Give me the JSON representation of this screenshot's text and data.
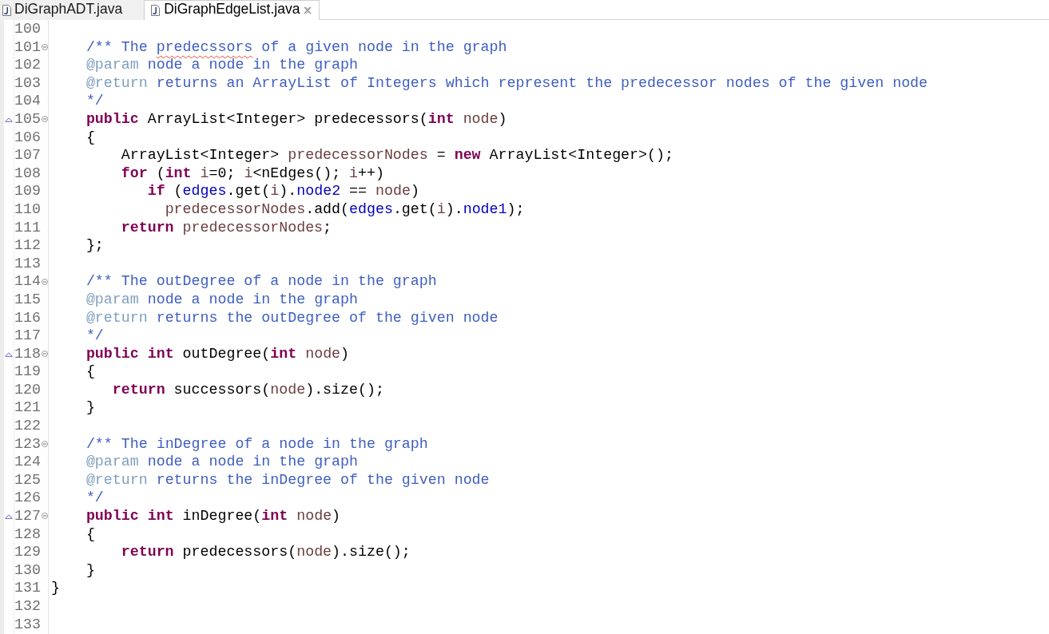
{
  "tabs": [
    {
      "label": "DiGraphADT.java",
      "selected": false
    },
    {
      "label": "DiGraphEdgeList.java",
      "selected": true
    }
  ],
  "editor": {
    "lines": [
      {
        "number": "100",
        "overrides": false,
        "foldable": false
      },
      {
        "number": "101",
        "overrides": false,
        "foldable": true,
        "tokens": [
          {
            "text": "    /** The ",
            "kind": "javadoc"
          },
          {
            "text": "predecssors",
            "kind": "spelling_error"
          },
          {
            "text": " of a given node in the graph",
            "kind": "javadoc"
          }
        ]
      },
      {
        "number": "102",
        "overrides": false,
        "foldable": false,
        "tokens": [
          {
            "text": "    @param",
            "kind": "javadoc_tag"
          },
          {
            "text": " node a node in the graph",
            "kind": "javadoc"
          }
        ]
      },
      {
        "number": "103",
        "overrides": false,
        "foldable": false,
        "tokens": [
          {
            "text": "    @return",
            "kind": "javadoc_tag"
          },
          {
            "text": " returns an ArrayList of Integers which represent the predecessor nodes of the given node",
            "kind": "javadoc"
          }
        ]
      },
      {
        "number": "104",
        "overrides": false,
        "foldable": false,
        "tokens": [
          {
            "text": "    */",
            "kind": "javadoc"
          }
        ]
      },
      {
        "number": "105",
        "overrides": true,
        "foldable": true,
        "tokens": [
          {
            "text": "    public",
            "kind": "keyword"
          },
          {
            "text": " ArrayList<Integer> predecessors(",
            "kind": "plain"
          },
          {
            "text": "int",
            "kind": "keyword"
          },
          {
            "text": " node",
            "kind": "variable"
          },
          {
            "text": ")",
            "kind": "plain"
          }
        ]
      },
      {
        "number": "106",
        "overrides": false,
        "foldable": false,
        "tokens": [
          {
            "text": "    {",
            "kind": "plain"
          }
        ]
      },
      {
        "number": "107",
        "overrides": false,
        "foldable": false,
        "tokens": [
          {
            "text": "        ArrayList<Integer> ",
            "kind": "plain"
          },
          {
            "text": "predecessorNodes",
            "kind": "variable"
          },
          {
            "text": " = ",
            "kind": "plain"
          },
          {
            "text": "new",
            "kind": "keyword"
          },
          {
            "text": " ArrayList<Integer>();",
            "kind": "plain"
          }
        ]
      },
      {
        "number": "108",
        "overrides": false,
        "foldable": false,
        "tokens": [
          {
            "text": "        for",
            "kind": "keyword"
          },
          {
            "text": " (",
            "kind": "plain"
          },
          {
            "text": "int",
            "kind": "keyword"
          },
          {
            "text": " i",
            "kind": "variable"
          },
          {
            "text": "=0; ",
            "kind": "plain"
          },
          {
            "text": "i",
            "kind": "variable"
          },
          {
            "text": "<nEdges(); ",
            "kind": "plain"
          },
          {
            "text": "i",
            "kind": "variable"
          },
          {
            "text": "++)",
            "kind": "plain"
          }
        ]
      },
      {
        "number": "109",
        "overrides": false,
        "foldable": false,
        "tokens": [
          {
            "text": "           if",
            "kind": "keyword"
          },
          {
            "text": " (",
            "kind": "plain"
          },
          {
            "text": "edges",
            "kind": "field"
          },
          {
            "text": ".get(",
            "kind": "plain"
          },
          {
            "text": "i",
            "kind": "variable"
          },
          {
            "text": ").",
            "kind": "plain"
          },
          {
            "text": "node2",
            "kind": "field"
          },
          {
            "text": " == ",
            "kind": "plain"
          },
          {
            "text": "node",
            "kind": "variable"
          },
          {
            "text": ")",
            "kind": "plain"
          }
        ]
      },
      {
        "number": "110",
        "overrides": false,
        "foldable": false,
        "tokens": [
          {
            "text": "             predecessorNodes",
            "kind": "variable"
          },
          {
            "text": ".add(",
            "kind": "plain"
          },
          {
            "text": "edges",
            "kind": "field"
          },
          {
            "text": ".get(",
            "kind": "plain"
          },
          {
            "text": "i",
            "kind": "variable"
          },
          {
            "text": ").",
            "kind": "plain"
          },
          {
            "text": "node1",
            "kind": "field"
          },
          {
            "text": ");",
            "kind": "plain"
          }
        ]
      },
      {
        "number": "111",
        "overrides": false,
        "foldable": false,
        "tokens": [
          {
            "text": "        return",
            "kind": "keyword"
          },
          {
            "text": " predecessorNodes",
            "kind": "variable"
          },
          {
            "text": ";",
            "kind": "plain"
          }
        ]
      },
      {
        "number": "112",
        "overrides": false,
        "foldable": false,
        "tokens": [
          {
            "text": "    };",
            "kind": "plain"
          }
        ]
      },
      {
        "number": "113",
        "overrides": false,
        "foldable": false
      },
      {
        "number": "114",
        "overrides": false,
        "foldable": true,
        "tokens": [
          {
            "text": "    /** The outDegree of a node in the graph",
            "kind": "javadoc"
          }
        ]
      },
      {
        "number": "115",
        "overrides": false,
        "foldable": false,
        "tokens": [
          {
            "text": "    @param",
            "kind": "javadoc_tag"
          },
          {
            "text": " node a node in the graph",
            "kind": "javadoc"
          }
        ]
      },
      {
        "number": "116",
        "overrides": false,
        "foldable": false,
        "tokens": [
          {
            "text": "    @return",
            "kind": "javadoc_tag"
          },
          {
            "text": " returns the outDegree of the given node",
            "kind": "javadoc"
          }
        ]
      },
      {
        "number": "117",
        "overrides": false,
        "foldable": false,
        "tokens": [
          {
            "text": "    */",
            "kind": "javadoc"
          }
        ]
      },
      {
        "number": "118",
        "overrides": true,
        "foldable": true,
        "tokens": [
          {
            "text": "    public int",
            "kind": "keyword"
          },
          {
            "text": " outDegree(",
            "kind": "plain"
          },
          {
            "text": "int",
            "kind": "keyword"
          },
          {
            "text": " node",
            "kind": "variable"
          },
          {
            "text": ")",
            "kind": "plain"
          }
        ]
      },
      {
        "number": "119",
        "overrides": false,
        "foldable": false,
        "tokens": [
          {
            "text": "    {",
            "kind": "plain"
          }
        ]
      },
      {
        "number": "120",
        "overrides": false,
        "foldable": false,
        "tokens": [
          {
            "text": "       return",
            "kind": "keyword"
          },
          {
            "text": " successors(",
            "kind": "plain"
          },
          {
            "text": "node",
            "kind": "variable"
          },
          {
            "text": ").size();",
            "kind": "plain"
          }
        ]
      },
      {
        "number": "121",
        "overrides": false,
        "foldable": false,
        "tokens": [
          {
            "text": "    }",
            "kind": "plain"
          }
        ]
      },
      {
        "number": "122",
        "overrides": false,
        "foldable": false
      },
      {
        "number": "123",
        "overrides": false,
        "foldable": true,
        "tokens": [
          {
            "text": "    /** The inDegree of a node in the graph",
            "kind": "javadoc"
          }
        ]
      },
      {
        "number": "124",
        "overrides": false,
        "foldable": false,
        "tokens": [
          {
            "text": "    @param",
            "kind": "javadoc_tag"
          },
          {
            "text": " node a node in the graph",
            "kind": "javadoc"
          }
        ]
      },
      {
        "number": "125",
        "overrides": false,
        "foldable": false,
        "tokens": [
          {
            "text": "    @return",
            "kind": "javadoc_tag"
          },
          {
            "text": " returns the inDegree of the given node",
            "kind": "javadoc"
          }
        ]
      },
      {
        "number": "126",
        "overrides": false,
        "foldable": false,
        "tokens": [
          {
            "text": "    */",
            "kind": "javadoc"
          }
        ]
      },
      {
        "number": "127",
        "overrides": true,
        "foldable": true,
        "tokens": [
          {
            "text": "    public int",
            "kind": "keyword"
          },
          {
            "text": " inDegree(",
            "kind": "plain"
          },
          {
            "text": "int",
            "kind": "keyword"
          },
          {
            "text": " node",
            "kind": "variable"
          },
          {
            "text": ")",
            "kind": "plain"
          }
        ]
      },
      {
        "number": "128",
        "overrides": false,
        "foldable": false,
        "tokens": [
          {
            "text": "    {",
            "kind": "plain"
          }
        ]
      },
      {
        "number": "129",
        "overrides": false,
        "foldable": false,
        "tokens": [
          {
            "text": "        return",
            "kind": "keyword"
          },
          {
            "text": " predecessors(",
            "kind": "plain"
          },
          {
            "text": "node",
            "kind": "variable"
          },
          {
            "text": ").size();",
            "kind": "plain"
          }
        ]
      },
      {
        "number": "130",
        "overrides": false,
        "foldable": false,
        "tokens": [
          {
            "text": "    }",
            "kind": "plain"
          }
        ]
      },
      {
        "number": "131",
        "overrides": false,
        "foldable": false,
        "tokens": [
          {
            "text": "}",
            "kind": "plain"
          }
        ]
      },
      {
        "number": "132",
        "overrides": false,
        "foldable": false
      },
      {
        "number": "133",
        "overrides": false,
        "foldable": false
      }
    ]
  }
}
